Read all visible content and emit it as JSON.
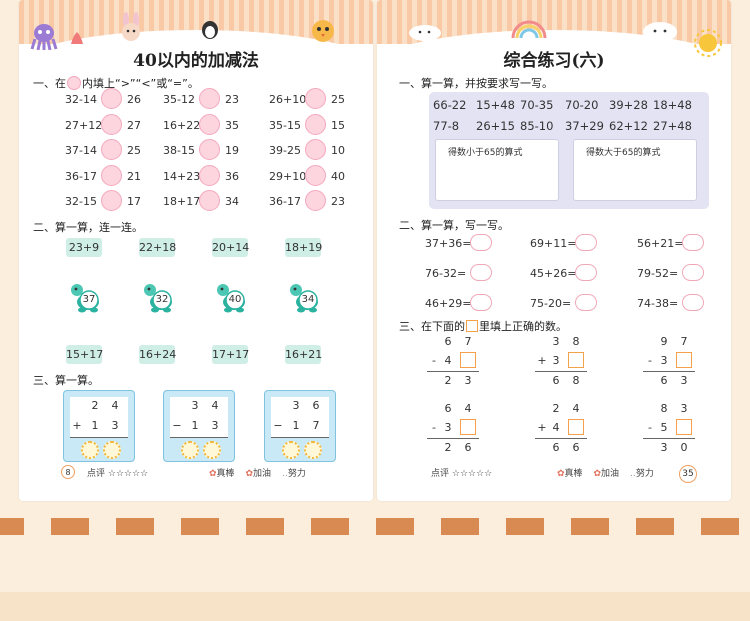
{
  "left": {
    "title": "40以内的加减法",
    "section1": {
      "prefix": "一、在",
      "suffix": "内填上“>”“<”或“=”。",
      "rows": [
        [
          {
            "l": "32-14",
            "r": "26"
          },
          {
            "l": "35-12",
            "r": "23"
          },
          {
            "l": "26+10",
            "r": "25"
          }
        ],
        [
          {
            "l": "27+12",
            "r": "27"
          },
          {
            "l": "16+22",
            "r": "35"
          },
          {
            "l": "35-15",
            "r": "15"
          }
        ],
        [
          {
            "l": "37-14",
            "r": "25"
          },
          {
            "l": "38-15",
            "r": "19"
          },
          {
            "l": "39-25",
            "r": "10"
          }
        ],
        [
          {
            "l": "36-17",
            "r": "21"
          },
          {
            "l": "14+23",
            "r": "36"
          },
          {
            "l": "29+10",
            "r": "40"
          }
        ],
        [
          {
            "l": "32-15",
            "r": "17"
          },
          {
            "l": "18+17",
            "r": "34"
          },
          {
            "l": "36-17",
            "r": "23"
          }
        ]
      ]
    },
    "section2": {
      "title": "二、算一算，连一连。",
      "top": [
        "23+9",
        "22+18",
        "20+14",
        "18+19"
      ],
      "turtles": [
        "37",
        "32",
        "40",
        "34"
      ],
      "bottom": [
        "15+17",
        "16+24",
        "17+17",
        "16+21"
      ]
    },
    "section3": {
      "title": "三、算一算。",
      "problems": [
        {
          "a": [
            "2",
            "4"
          ],
          "op": "+",
          "b": [
            "1",
            "3"
          ]
        },
        {
          "a": [
            "3",
            "4"
          ],
          "op": "−",
          "b": [
            "1",
            "3"
          ]
        },
        {
          "a": [
            "3",
            "6"
          ],
          "op": "−",
          "b": [
            "1",
            "7"
          ]
        }
      ]
    },
    "footer": {
      "page": "8",
      "rate": "点评",
      "stars": "☆☆☆☆☆",
      "r1": "真棒",
      "r2": "加油",
      "r3": "努力"
    }
  },
  "right": {
    "title": "综合练习(六)",
    "section1": {
      "title": "一、算一算，并按要求写一写。",
      "row1": [
        "66-22",
        "15+48",
        "70-35",
        "70-20",
        "39+28",
        "18+48"
      ],
      "row2": [
        "77-8",
        "26+15",
        "85-10",
        "37+29",
        "62+12",
        "27+48"
      ],
      "box_left": "得数小于65的算式",
      "box_right": "得数大于65的算式"
    },
    "section2": {
      "title": "二、算一算，写一写。",
      "items": [
        "37+36=",
        "69+11=",
        "56+21=",
        "76-32=",
        "45+26=",
        "79-52=",
        "46+29=",
        "75-20=",
        "74-38="
      ]
    },
    "section3": {
      "prefix": "三、在下面的",
      "suffix": "里填上正确的数。",
      "problems": [
        {
          "top": [
            "6",
            "7"
          ],
          "op": "-",
          "mid": [
            "4",
            ""
          ],
          "res": [
            "2",
            "3"
          ]
        },
        {
          "top": [
            "3",
            "8"
          ],
          "op": "+",
          "mid": [
            "3",
            ""
          ],
          "res": [
            "6",
            "8"
          ]
        },
        {
          "top": [
            "9",
            "7"
          ],
          "op": "-",
          "mid": [
            "3",
            ""
          ],
          "res": [
            "6",
            "3"
          ]
        },
        {
          "top": [
            "6",
            "4"
          ],
          "op": "-",
          "mid": [
            "3",
            ""
          ],
          "res": [
            "2",
            "6"
          ]
        },
        {
          "top": [
            "2",
            "4"
          ],
          "op": "+",
          "mid": [
            "4",
            ""
          ],
          "res": [
            "6",
            "6"
          ]
        },
        {
          "top": [
            "8",
            "3"
          ],
          "op": "-",
          "mid": [
            "5",
            ""
          ],
          "res": [
            "3",
            "0"
          ]
        }
      ]
    },
    "footer": {
      "page": "35",
      "rate": "点评",
      "stars": "☆☆☆☆☆",
      "r1": "真棒",
      "r2": "加油",
      "r3": "努力"
    }
  },
  "colors": {
    "bg": "#fbeedd",
    "pink": "#fcd5df",
    "teal": "#cfeee6",
    "blue": "#c8e9f5",
    "orange": "#f5a04a",
    "stripe": "#d88a52"
  }
}
